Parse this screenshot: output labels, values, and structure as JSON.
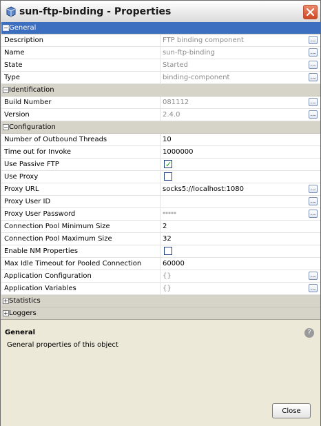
{
  "window": {
    "title": "sun-ftp-binding - Properties"
  },
  "sections": {
    "general": {
      "label": "General",
      "expanded": true,
      "rows": [
        {
          "name": "Description",
          "value": "FTP binding component"
        },
        {
          "name": "Name",
          "value": "sun-ftp-binding"
        },
        {
          "name": "State",
          "value": "Started"
        },
        {
          "name": "Type",
          "value": "binding-component"
        }
      ]
    },
    "identification": {
      "label": "Identification",
      "expanded": true,
      "rows": [
        {
          "name": "Build Number",
          "value": "081112"
        },
        {
          "name": "Version",
          "value": "2.4.0"
        }
      ]
    },
    "configuration": {
      "label": "Configuration",
      "expanded": true,
      "rows": [
        {
          "name": "Number of Outbound Threads",
          "value": "10"
        },
        {
          "name": "Time out for Invoke",
          "value": "1000000"
        },
        {
          "name": "Use Passive FTP",
          "checked": true
        },
        {
          "name": "Use Proxy",
          "checked": false
        },
        {
          "name": "Proxy URL",
          "value": "socks5://localhost:1080"
        },
        {
          "name": "Proxy User ID",
          "value": ""
        },
        {
          "name": "Proxy User Password",
          "value": "*****"
        },
        {
          "name": "Connection Pool Minimum Size",
          "value": "2"
        },
        {
          "name": "Connection Pool Maximum Size",
          "value": "32"
        },
        {
          "name": "Enable NM Properties",
          "checked": false
        },
        {
          "name": "Max Idle Timeout for Pooled Connection",
          "value": "60000"
        },
        {
          "name": "Application Configuration",
          "value": "{}"
        },
        {
          "name": "Application Variables",
          "value": "{}"
        }
      ]
    },
    "statistics": {
      "label": "Statistics",
      "expanded": false
    },
    "loggers": {
      "label": "Loggers",
      "expanded": false
    }
  },
  "description_panel": {
    "title": "General",
    "text": "General properties of this object"
  },
  "buttons": {
    "close": "Close"
  },
  "icons": {
    "expanded_symbol": "−",
    "collapsed_symbol": "+",
    "ellipsis": "...",
    "check": "✓",
    "help": "?"
  },
  "colors": {
    "selected_section": "#3d6fc0",
    "section_bg": "#d6d3c9",
    "readonly_text": "#8c8c8c",
    "check": "#1b9b1b"
  }
}
